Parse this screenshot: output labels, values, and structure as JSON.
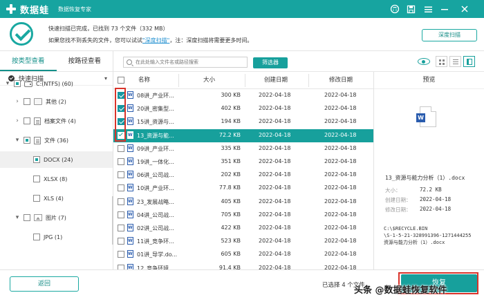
{
  "app": {
    "name": "数据蛙",
    "tagline": "数据恢复专家",
    "accent": "#17a09c",
    "alert_red": "#d9332a"
  },
  "window_buttons": [
    "feedback-icon",
    "save-icon",
    "menu-icon",
    "minimize-icon",
    "close-icon"
  ],
  "info": {
    "status": "快速扫描已完成，已找到 73 个文件（332 MB）",
    "hint_prefix": "如果您找不到丢失的文件，您可以试试",
    "hint_link": "\"深度扫描\"",
    "hint_suffix": "，注：深度扫描将需要更多时间。",
    "deep_scan_button": "深度扫描"
  },
  "left": {
    "tabs": [
      "按类型查看",
      "按路径查看"
    ],
    "active_tab": 0,
    "scan_mode": "快速扫描",
    "tree": [
      {
        "label": "C:(NTFS) (60)",
        "level": 0,
        "arrow": "▾",
        "state": "partial",
        "icon": "drive"
      },
      {
        "label": "其他 (2)",
        "level": 1,
        "arrow": "›",
        "state": "empty",
        "icon": "folder"
      },
      {
        "label": "档案文件 (4)",
        "level": 1,
        "arrow": "›",
        "state": "empty",
        "icon": "doc"
      },
      {
        "label": "文件 (36)",
        "level": 1,
        "arrow": "▾",
        "state": "partial",
        "icon": "doc"
      },
      {
        "label": "DOCX (24)",
        "level": 2,
        "arrow": "",
        "state": "partial",
        "icon": "",
        "selected": true
      },
      {
        "label": "XLSX (8)",
        "level": 2,
        "arrow": "",
        "state": "empty",
        "icon": ""
      },
      {
        "label": "XLS (4)",
        "level": 2,
        "arrow": "",
        "state": "empty",
        "icon": ""
      },
      {
        "label": "图片 (7)",
        "level": 1,
        "arrow": "▾",
        "state": "empty",
        "icon": "image"
      },
      {
        "label": "JPG (1)",
        "level": 2,
        "arrow": "",
        "state": "empty",
        "icon": ""
      }
    ]
  },
  "toolbar": {
    "search_placeholder": "在此处输入文件名或路径搜索",
    "filter_button": "筛选器"
  },
  "table": {
    "headers": [
      "名称",
      "大小",
      "创建日期",
      "修改日期"
    ],
    "rows": [
      {
        "name": "08讲_产业环...",
        "size": "300 KB",
        "created": "2022-04-18",
        "modified": "2022-04-18",
        "checked": true,
        "selected": false
      },
      {
        "name": "20讲_密集型...",
        "size": "402 KB",
        "created": "2022-04-18",
        "modified": "2022-04-18",
        "checked": true,
        "selected": false
      },
      {
        "name": "15讲_资源与...",
        "size": "194 KB",
        "created": "2022-04-18",
        "modified": "2022-04-18",
        "checked": true,
        "selected": false
      },
      {
        "name": "13_资源与能...",
        "size": "72.2 KB",
        "created": "2022-04-18",
        "modified": "2022-04-18",
        "checked": true,
        "selected": true
      },
      {
        "name": "09讲_产业环...",
        "size": "335 KB",
        "created": "2022-04-18",
        "modified": "2022-04-18",
        "checked": false,
        "selected": false
      },
      {
        "name": "19讲_一体化...",
        "size": "351 KB",
        "created": "2022-04-18",
        "modified": "2022-04-18",
        "checked": false,
        "selected": false
      },
      {
        "name": "06讲_公司战...",
        "size": "202 KB",
        "created": "2022-04-18",
        "modified": "2022-04-18",
        "checked": false,
        "selected": false
      },
      {
        "name": "10讲_产业环...",
        "size": "77.8 KB",
        "created": "2022-04-18",
        "modified": "2022-04-18",
        "checked": false,
        "selected": false
      },
      {
        "name": "23_发展战略...",
        "size": "405 KB",
        "created": "2022-04-18",
        "modified": "2022-04-18",
        "checked": false,
        "selected": false
      },
      {
        "name": "04讲_公司战...",
        "size": "705 KB",
        "created": "2022-04-18",
        "modified": "2022-04-18",
        "checked": false,
        "selected": false
      },
      {
        "name": "02讲_公司战...",
        "size": "422 KB",
        "created": "2022-04-18",
        "modified": "2022-04-18",
        "checked": false,
        "selected": false
      },
      {
        "name": "11讲_竞争环...",
        "size": "523 KB",
        "created": "2022-04-18",
        "modified": "2022-04-18",
        "checked": false,
        "selected": false
      },
      {
        "name": "01讲_导学.do...",
        "size": "605 KB",
        "created": "2022-04-18",
        "modified": "2022-04-18",
        "checked": false,
        "selected": false
      },
      {
        "name": "12_竞争环境...",
        "size": "91.4 KB",
        "created": "2022-04-18",
        "modified": "2022-04-18",
        "checked": false,
        "selected": false
      }
    ]
  },
  "preview": {
    "title": "预览",
    "filename": "13_资源与能力分析（1）.docx",
    "size_label": "大小：",
    "size_value": "72.2 KB",
    "created_label": "创建日期：",
    "created_value": "2022-04-18",
    "modified_label": "修改日期：",
    "modified_value": "2022-04-18",
    "path": "C:\\$RECYCLE.BIN\n\\S-1-5-21-328991396-1271444255\n资源与能力分析（1）.docx"
  },
  "footer": {
    "back_button": "返回",
    "selected_info": "已选择 4 个文件",
    "recover_button": "恢复",
    "watermark": "头条 @数据蛙恢复软件"
  }
}
